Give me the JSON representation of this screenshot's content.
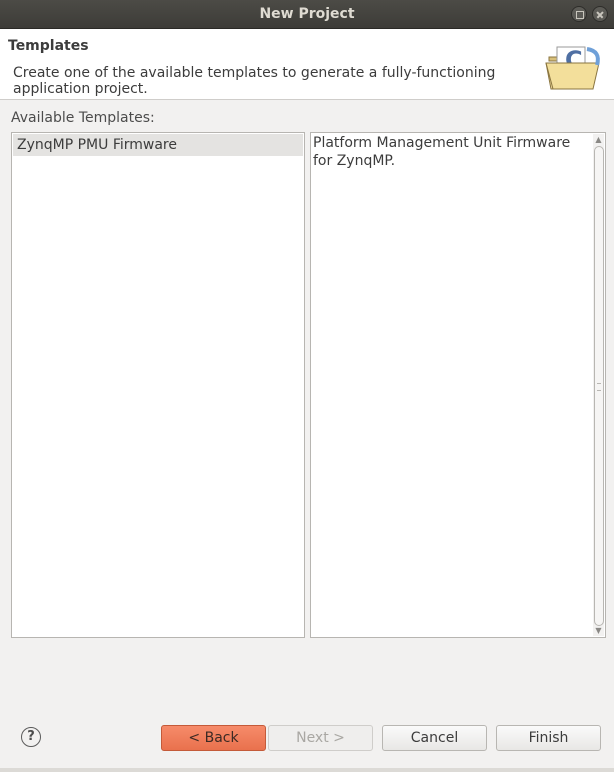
{
  "window": {
    "title": "New Project"
  },
  "header": {
    "heading": "Templates",
    "description": "Create one of the available templates to generate a fully-functioning application project.",
    "banner_icon": "new-c-project-folder-icon"
  },
  "templates": {
    "label": "Available Templates:",
    "items": [
      {
        "label": "ZynqMP PMU Firmware",
        "selected": true
      }
    ],
    "description": "Platform Management Unit Firmware for ZynqMP."
  },
  "buttons": {
    "help": "?",
    "back": "< Back",
    "next": "Next >",
    "cancel": "Cancel",
    "finish": "Finish"
  },
  "colors": {
    "accent_button": "#f07c58",
    "titlebar": "#3d3c38",
    "selection": "#e4e3e1"
  }
}
